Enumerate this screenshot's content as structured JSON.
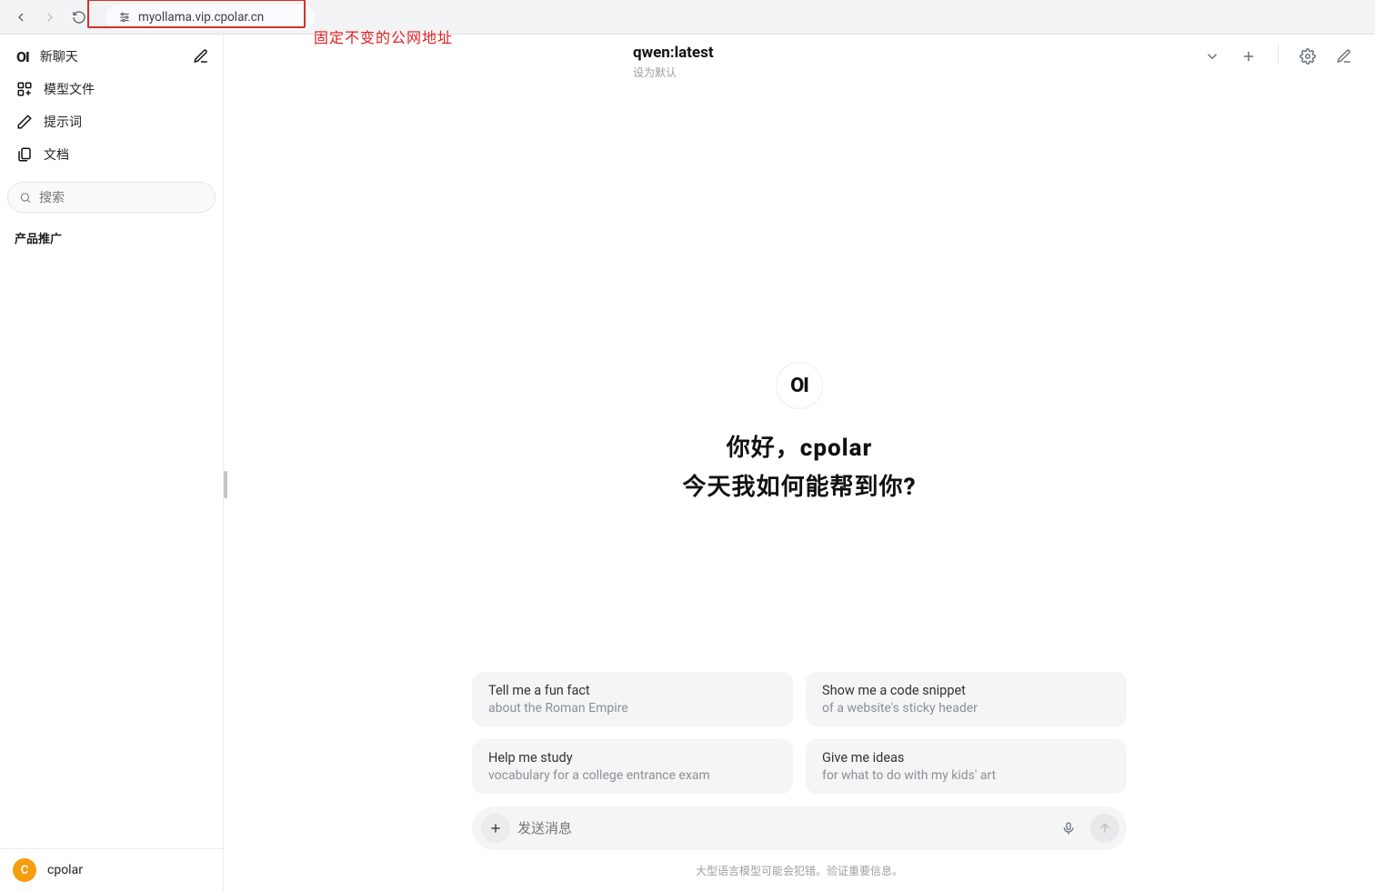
{
  "browser": {
    "address": "myollama.vip.cpolar.cn",
    "annotation": "固定不变的公网地址"
  },
  "sidebar": {
    "items": [
      {
        "label": "新聊天"
      },
      {
        "label": "模型文件"
      },
      {
        "label": "提示词"
      },
      {
        "label": "文档"
      }
    ],
    "search_placeholder": "搜索",
    "section_label": "产品推广",
    "user": {
      "initial": "C",
      "name": "cpolar"
    }
  },
  "main": {
    "model": {
      "name": "qwen:latest",
      "subtitle": "设为默认"
    },
    "logo_text": "OI",
    "greeting_line1": "你好，cpolar",
    "greeting_line2": "今天我如何能帮到你?",
    "suggestions": [
      {
        "title": "Tell me a fun fact",
        "sub": "about the Roman Empire"
      },
      {
        "title": "Show me a code snippet",
        "sub": "of a website's sticky header"
      },
      {
        "title": "Help me study",
        "sub": "vocabulary for a college entrance exam"
      },
      {
        "title": "Give me ideas",
        "sub": "for what to do with my kids' art"
      }
    ],
    "composer_placeholder": "发送消息",
    "disclaimer": "大型语言模型可能会犯错。验证重要信息。"
  }
}
